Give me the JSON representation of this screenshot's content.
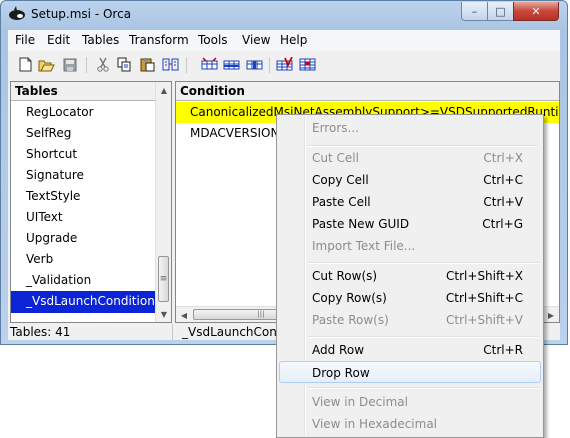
{
  "window": {
    "title": "Setup.msi - Orca",
    "minimize_glyph": "–",
    "maximize_glyph": "□",
    "close_glyph": "✕"
  },
  "menubar": {
    "items": [
      "File",
      "Edit",
      "Tables",
      "Transform",
      "Tools",
      "View",
      "Help"
    ]
  },
  "toolbar": {
    "buttons": [
      "new-icon",
      "open-icon",
      "save-icon",
      "cut-icon",
      "copy-icon",
      "paste-icon",
      "find-icon",
      "tables-icon",
      "rows-icon",
      "columns-icon",
      "validate-icon",
      "merge-icon"
    ]
  },
  "tables_pane": {
    "header": "Tables",
    "items": [
      "RegLocator",
      "SelfReg",
      "Shortcut",
      "Signature",
      "TextStyle",
      "UIText",
      "Upgrade",
      "Verb",
      "_Validation",
      "_VsdLaunchCondition"
    ],
    "selected": "_VsdLaunchCondition"
  },
  "data_pane": {
    "header": "Condition",
    "rows": [
      "CanonicalizedMsiNetAssemblySupport>=VSDSupportedRuntimesMin",
      "MDACVERSION"
    ]
  },
  "scroll_glyphs": {
    "up": "▲",
    "down": "▼",
    "left": "◀",
    "right": "▶",
    "grip_v": "≡",
    "grip_h": "|||"
  },
  "statusbar": {
    "tables_count": "Tables: 41",
    "current_table": "_VsdLaunchConditi"
  },
  "context_menu": {
    "items": [
      {
        "label": "Errors...",
        "shortcut": "",
        "disabled": true
      },
      {
        "label": "Cut Cell",
        "shortcut": "Ctrl+X",
        "disabled": true
      },
      {
        "label": "Copy Cell",
        "shortcut": "Ctrl+C",
        "disabled": false
      },
      {
        "label": "Paste Cell",
        "shortcut": "Ctrl+V",
        "disabled": false
      },
      {
        "label": "Paste New GUID",
        "shortcut": "Ctrl+G",
        "disabled": false
      },
      {
        "label": "Import Text File...",
        "shortcut": "",
        "disabled": true
      },
      {
        "label": "Cut Row(s)",
        "shortcut": "Ctrl+Shift+X",
        "disabled": false
      },
      {
        "label": "Copy Row(s)",
        "shortcut": "Ctrl+Shift+C",
        "disabled": false
      },
      {
        "label": "Paste Row(s)",
        "shortcut": "Ctrl+Shift+V",
        "disabled": true
      },
      {
        "label": "Add Row",
        "shortcut": "Ctrl+R",
        "disabled": false
      },
      {
        "label": "Drop Row",
        "shortcut": "",
        "disabled": false,
        "hover": true
      },
      {
        "label": "View in Decimal",
        "shortcut": "",
        "disabled": true
      },
      {
        "label": "View in Hexadecimal",
        "shortcut": "",
        "disabled": true
      }
    ]
  },
  "colors": {
    "selection": "#0a24d6",
    "row_highlight": "#ffff00",
    "menu_hover_border": "#aecff7"
  }
}
